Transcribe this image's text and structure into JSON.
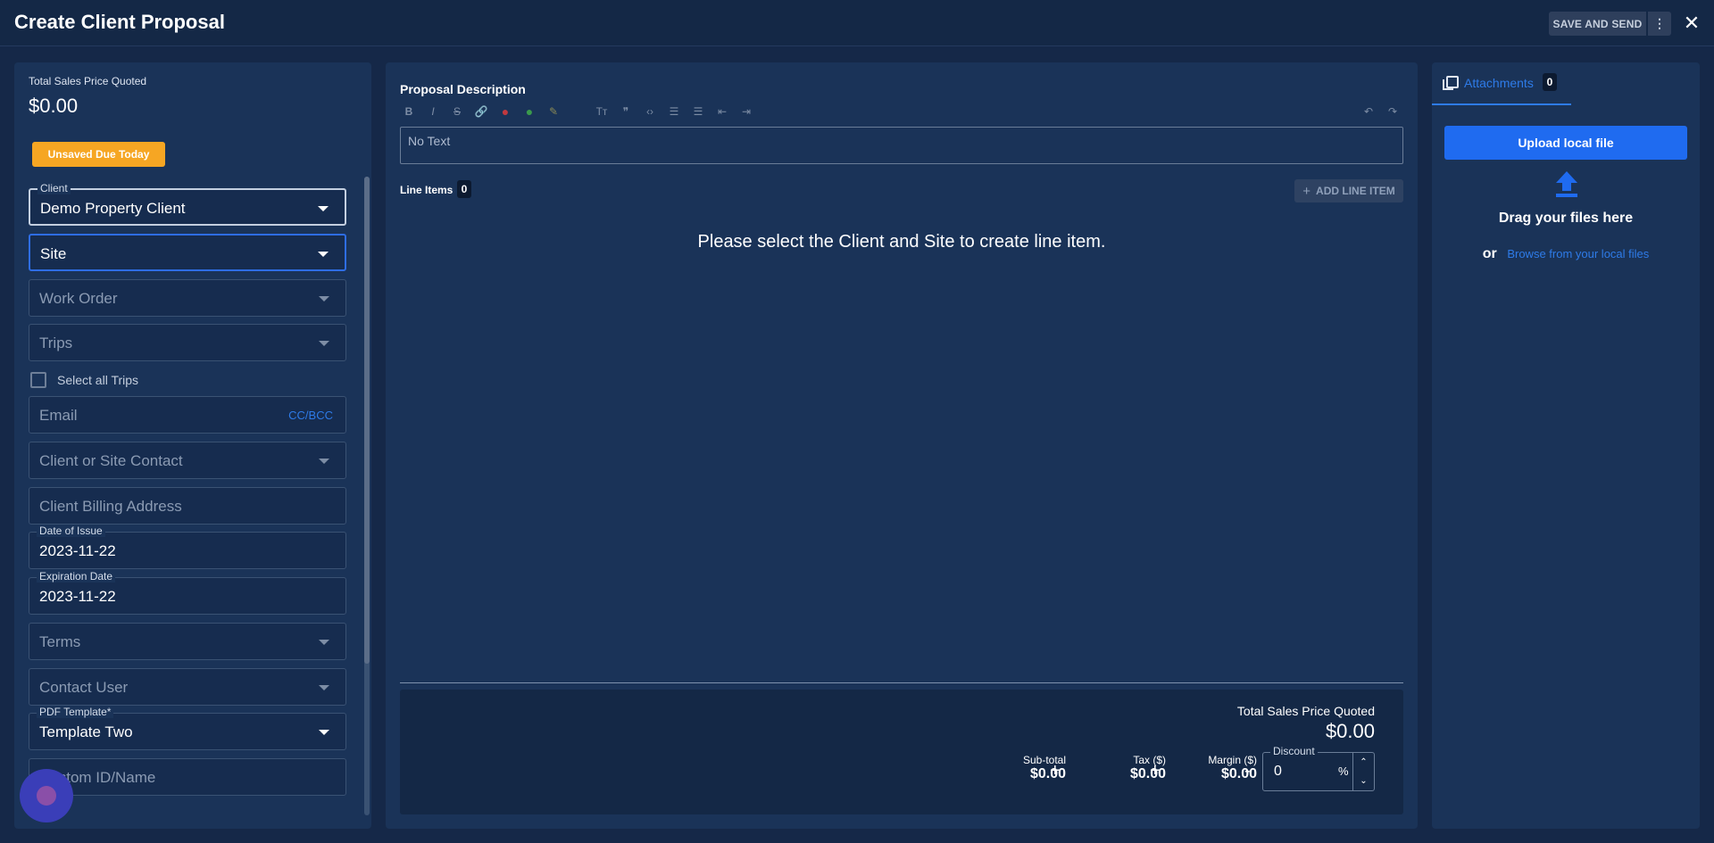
{
  "header": {
    "title": "Create Client Proposal",
    "save_label": "SAVE AND SEND",
    "more_label": "⋮",
    "close_label": "✕"
  },
  "left": {
    "total_label": "Total Sales Price Quoted",
    "total_value": "$0.00",
    "status_badge": "Unsaved Due Today",
    "client": {
      "legend": "Client",
      "value": "Demo Property Client"
    },
    "site": {
      "placeholder": "Site"
    },
    "work_order": {
      "placeholder": "Work Order"
    },
    "trips": {
      "placeholder": "Trips"
    },
    "select_all_trips": "Select all Trips",
    "email": {
      "placeholder": "Email",
      "cc_bcc": "CC/BCC"
    },
    "contact": {
      "placeholder": "Client or Site Contact"
    },
    "billing": {
      "placeholder": "Client Billing Address"
    },
    "date_of_issue": {
      "legend": "Date of Issue",
      "value": "2023-11-22"
    },
    "expiration_date": {
      "legend": "Expiration Date",
      "value": "2023-11-22"
    },
    "terms": {
      "placeholder": "Terms"
    },
    "contact_user": {
      "placeholder": "Contact User"
    },
    "pdf_template": {
      "legend": "PDF Template*",
      "value": "Template Two"
    },
    "custom_id": {
      "placeholder": "Custom ID/Name"
    }
  },
  "center": {
    "description_label": "Proposal Description",
    "editor_text": "No Text",
    "toolbar": {
      "bold": "B",
      "italic": "I",
      "strike": "S",
      "link": "🔗",
      "red": "●",
      "green": "●",
      "pen": "✎",
      "text_size": "Tт",
      "quote": "❞",
      "code": "‹›",
      "bullets": "☰",
      "numbered": "☰",
      "outdent": "⇤",
      "indent": "⇥",
      "undo": "↶",
      "redo": "↷"
    },
    "line_items_label": "Line Items",
    "line_items_count": "0",
    "add_line_item_label": "ADD LINE ITEM",
    "add_plus": "+",
    "empty_message": "Please select the Client and Site to create line item.",
    "totals": {
      "total_label": "Total Sales Price Quoted",
      "total_value": "$0.00",
      "subtotal_label": "Sub-total",
      "subtotal_value": "$0.00",
      "tax_label": "Tax ($)",
      "tax_value": "$0.00",
      "margin_label": "Margin ($)",
      "margin_value": "$0.00",
      "plus": "+",
      "minus": "-",
      "discount_label": "Discount",
      "discount_value": "0",
      "discount_unit": "%",
      "spin_up": "⌃",
      "spin_down": "⌄"
    }
  },
  "right": {
    "tab_label": "Attachments",
    "tab_count": "0",
    "upload_label": "Upload local file",
    "drag_text": "Drag your files here",
    "or_text": "or",
    "browse_text": "Browse from your local files",
    "accent": "#1f6bf0"
  }
}
